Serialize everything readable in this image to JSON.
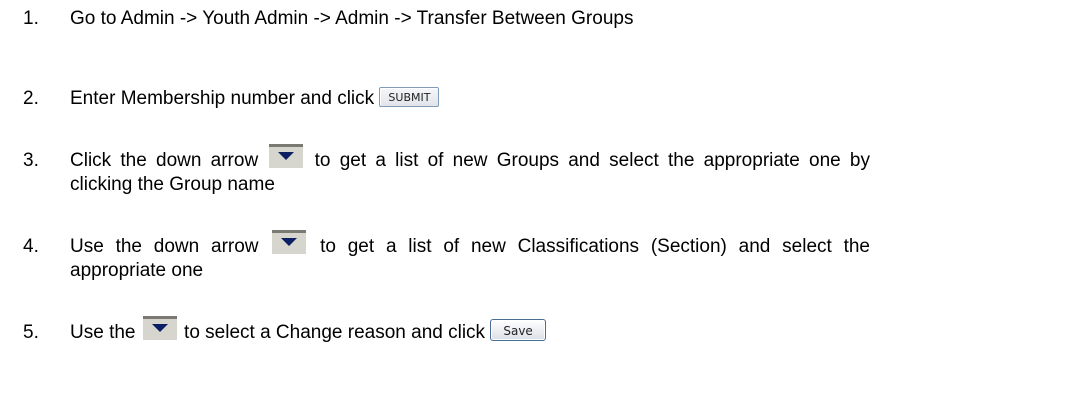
{
  "steps": [
    {
      "number": "1.",
      "text": "Go to Admin -> Youth Admin -> Admin -> Transfer Between Groups"
    },
    {
      "number": "2.",
      "text_before": "Enter Membership number and click ",
      "button_label": "SUBMIT"
    },
    {
      "number": "3.",
      "text_before": "Click the down arrow ",
      "text_after": " to get a list of new Groups and select the appropriate one by clicking the Group name",
      "icon": "dropdown-arrow-icon"
    },
    {
      "number": "4.",
      "text_before": "Use the down arrow ",
      "text_after": " to get a list of new Classifications (Section) and select the appropriate one",
      "icon": "dropdown-arrow-icon"
    },
    {
      "number": "5.",
      "text_before": "Use the ",
      "text_after": " to select a Change reason and click ",
      "button_label": "Save",
      "icon": "dropdown-arrow-icon"
    }
  ],
  "colors": {
    "text": "#000000",
    "arrow_bg": "#d6d6cf",
    "arrow_border": "#7a7a72",
    "button_border": "#7f9db9"
  }
}
